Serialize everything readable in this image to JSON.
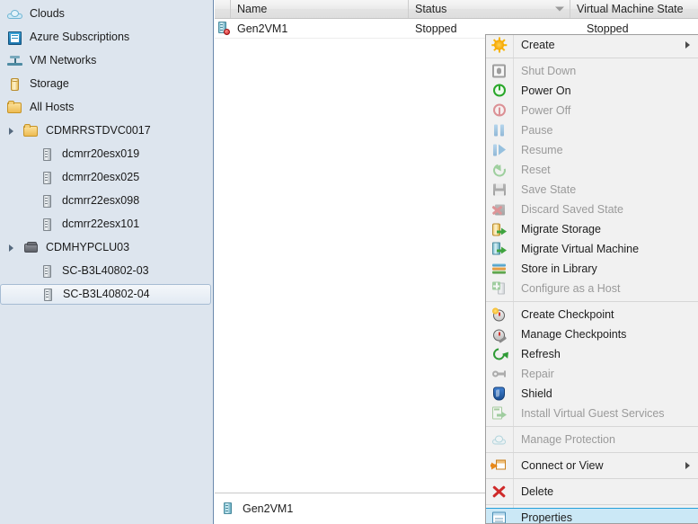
{
  "sidebar": {
    "items": [
      {
        "label": "Clouds",
        "icon": "cloud-icon",
        "indent": 0,
        "expander": "",
        "selected": false
      },
      {
        "label": "Azure Subscriptions",
        "icon": "azure-subscriptions-icon",
        "indent": 0,
        "expander": "",
        "selected": false
      },
      {
        "label": "VM Networks",
        "icon": "vm-networks-icon",
        "indent": 0,
        "expander": "",
        "selected": false
      },
      {
        "label": "Storage",
        "icon": "storage-icon",
        "indent": 0,
        "expander": "",
        "selected": false
      },
      {
        "label": "All Hosts",
        "icon": "folder-icon",
        "indent": 0,
        "expander": "",
        "selected": false
      },
      {
        "label": "CDMRRSTDVC0017",
        "icon": "folder-icon",
        "indent": 1,
        "expander": "collapsed",
        "selected": false
      },
      {
        "label": "dcmrr20esx019",
        "icon": "host-icon",
        "indent": 2,
        "expander": "",
        "selected": false
      },
      {
        "label": "dcmrr20esx025",
        "icon": "host-icon",
        "indent": 2,
        "expander": "",
        "selected": false
      },
      {
        "label": "dcmrr22esx098",
        "icon": "host-icon",
        "indent": 2,
        "expander": "",
        "selected": false
      },
      {
        "label": "dcmrr22esx101",
        "icon": "host-icon",
        "indent": 2,
        "expander": "",
        "selected": false
      },
      {
        "label": "CDMHYPCLU03",
        "icon": "cluster-icon",
        "indent": 1,
        "expander": "collapsed",
        "selected": false
      },
      {
        "label": "SC-B3L40802-03",
        "icon": "host-icon",
        "indent": 2,
        "expander": "",
        "selected": false
      },
      {
        "label": "SC-B3L40802-04",
        "icon": "host-icon",
        "indent": 2,
        "expander": "",
        "selected": true
      }
    ]
  },
  "list": {
    "columns": [
      {
        "label": "Name",
        "key": "c-name"
      },
      {
        "label": "Status",
        "key": "c-status",
        "sorted": true
      },
      {
        "label": "Virtual Machine State",
        "key": "c-vmstate"
      }
    ],
    "rows": [
      {
        "icon": "vm-stopped-icon",
        "name": "Gen2VM1",
        "status": "Stopped",
        "vm_state": "Stopped"
      }
    ]
  },
  "statusbar": {
    "icon": "vm-icon",
    "label": "Gen2VM1"
  },
  "context_menu": {
    "items": [
      {
        "label": "Create",
        "icon": "create-icon",
        "disabled": false,
        "submenu": true,
        "highlight": false,
        "sep_after": true
      },
      {
        "label": "Shut Down",
        "icon": "shut-down-icon",
        "disabled": true,
        "submenu": false,
        "highlight": false,
        "sep_after": false
      },
      {
        "label": "Power On",
        "icon": "power-on-icon",
        "disabled": false,
        "submenu": false,
        "highlight": false,
        "sep_after": false
      },
      {
        "label": "Power Off",
        "icon": "power-off-icon",
        "disabled": true,
        "submenu": false,
        "highlight": false,
        "sep_after": false
      },
      {
        "label": "Pause",
        "icon": "pause-icon",
        "disabled": true,
        "submenu": false,
        "highlight": false,
        "sep_after": false
      },
      {
        "label": "Resume",
        "icon": "resume-icon",
        "disabled": true,
        "submenu": false,
        "highlight": false,
        "sep_after": false
      },
      {
        "label": "Reset",
        "icon": "reset-icon",
        "disabled": true,
        "submenu": false,
        "highlight": false,
        "sep_after": false
      },
      {
        "label": "Save State",
        "icon": "save-state-icon",
        "disabled": true,
        "submenu": false,
        "highlight": false,
        "sep_after": false
      },
      {
        "label": "Discard Saved State",
        "icon": "discard-saved-state-icon",
        "disabled": true,
        "submenu": false,
        "highlight": false,
        "sep_after": false
      },
      {
        "label": "Migrate Storage",
        "icon": "migrate-storage-icon",
        "disabled": false,
        "submenu": false,
        "highlight": false,
        "sep_after": false
      },
      {
        "label": "Migrate Virtual Machine",
        "icon": "migrate-vm-icon",
        "disabled": false,
        "submenu": false,
        "highlight": false,
        "sep_after": false
      },
      {
        "label": "Store in Library",
        "icon": "store-in-library-icon",
        "disabled": false,
        "submenu": false,
        "highlight": false,
        "sep_after": false
      },
      {
        "label": "Configure as a Host",
        "icon": "configure-as-host-icon",
        "disabled": true,
        "submenu": false,
        "highlight": false,
        "sep_after": true
      },
      {
        "label": "Create Checkpoint",
        "icon": "create-checkpoint-icon",
        "disabled": false,
        "submenu": false,
        "highlight": false,
        "sep_after": false
      },
      {
        "label": "Manage Checkpoints",
        "icon": "manage-checkpoints-icon",
        "disabled": false,
        "submenu": false,
        "highlight": false,
        "sep_after": false
      },
      {
        "label": "Refresh",
        "icon": "refresh-icon",
        "disabled": false,
        "submenu": false,
        "highlight": false,
        "sep_after": false
      },
      {
        "label": "Repair",
        "icon": "repair-icon",
        "disabled": true,
        "submenu": false,
        "highlight": false,
        "sep_after": false
      },
      {
        "label": "Shield",
        "icon": "shield-icon",
        "disabled": false,
        "submenu": false,
        "highlight": false,
        "sep_after": false
      },
      {
        "label": "Install Virtual Guest Services",
        "icon": "install-guest-services-icon",
        "disabled": true,
        "submenu": false,
        "highlight": false,
        "sep_after": true
      },
      {
        "label": "Manage Protection",
        "icon": "manage-protection-icon",
        "disabled": true,
        "submenu": false,
        "highlight": false,
        "sep_after": true
      },
      {
        "label": "Connect or View",
        "icon": "connect-or-view-icon",
        "disabled": false,
        "submenu": true,
        "highlight": false,
        "sep_after": true
      },
      {
        "label": "Delete",
        "icon": "delete-icon",
        "disabled": false,
        "submenu": false,
        "highlight": false,
        "sep_after": true
      },
      {
        "label": "Properties",
        "icon": "properties-icon",
        "disabled": false,
        "submenu": false,
        "highlight": true,
        "sep_after": false
      }
    ]
  },
  "colors": {
    "sidebar_bg": "#dde5ee",
    "menu_bg": "#f1f1f1",
    "highlight_bg": "#cbe8f6",
    "highlight_border": "#26a0da",
    "disabled_text": "#9a9a9a"
  }
}
